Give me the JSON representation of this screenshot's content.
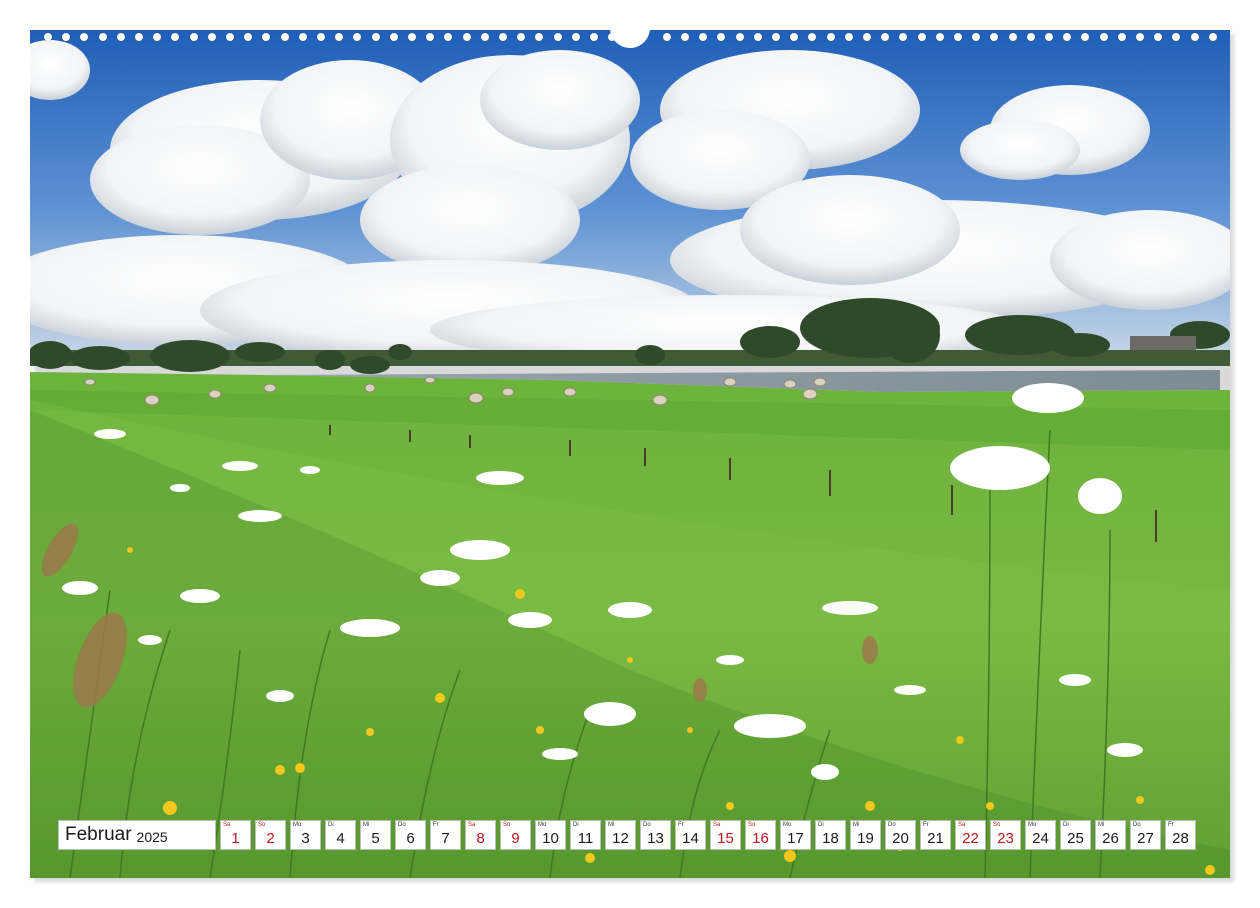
{
  "calendar": {
    "month": "Februar",
    "year": "2025",
    "days": [
      {
        "wd": "Sa",
        "d": "1",
        "weekend": true
      },
      {
        "wd": "So",
        "d": "2",
        "weekend": true
      },
      {
        "wd": "Mo",
        "d": "3",
        "weekend": false
      },
      {
        "wd": "Di",
        "d": "4",
        "weekend": false
      },
      {
        "wd": "Mi",
        "d": "5",
        "weekend": false
      },
      {
        "wd": "Do",
        "d": "6",
        "weekend": false
      },
      {
        "wd": "Fr",
        "d": "7",
        "weekend": false
      },
      {
        "wd": "Sa",
        "d": "8",
        "weekend": true
      },
      {
        "wd": "So",
        "d": "9",
        "weekend": true
      },
      {
        "wd": "Mo",
        "d": "10",
        "weekend": false
      },
      {
        "wd": "Di",
        "d": "11",
        "weekend": false
      },
      {
        "wd": "Mi",
        "d": "12",
        "weekend": false
      },
      {
        "wd": "Do",
        "d": "13",
        "weekend": false
      },
      {
        "wd": "Fr",
        "d": "14",
        "weekend": false
      },
      {
        "wd": "Sa",
        "d": "15",
        "weekend": true
      },
      {
        "wd": "So",
        "d": "16",
        "weekend": true
      },
      {
        "wd": "Mo",
        "d": "17",
        "weekend": false
      },
      {
        "wd": "Di",
        "d": "18",
        "weekend": false
      },
      {
        "wd": "Mi",
        "d": "19",
        "weekend": false
      },
      {
        "wd": "Do",
        "d": "20",
        "weekend": false
      },
      {
        "wd": "Fr",
        "d": "21",
        "weekend": false
      },
      {
        "wd": "Sa",
        "d": "22",
        "weekend": true
      },
      {
        "wd": "So",
        "d": "23",
        "weekend": true
      },
      {
        "wd": "Mo",
        "d": "24",
        "weekend": false
      },
      {
        "wd": "Di",
        "d": "25",
        "weekend": false
      },
      {
        "wd": "Mi",
        "d": "26",
        "weekend": false
      },
      {
        "wd": "Do",
        "d": "27",
        "weekend": false
      },
      {
        "wd": "Fr",
        "d": "28",
        "weekend": false
      }
    ]
  },
  "colors": {
    "weekend": "#c4161c",
    "sky": "#2f6fc4",
    "meadow": "#6fb43a"
  }
}
